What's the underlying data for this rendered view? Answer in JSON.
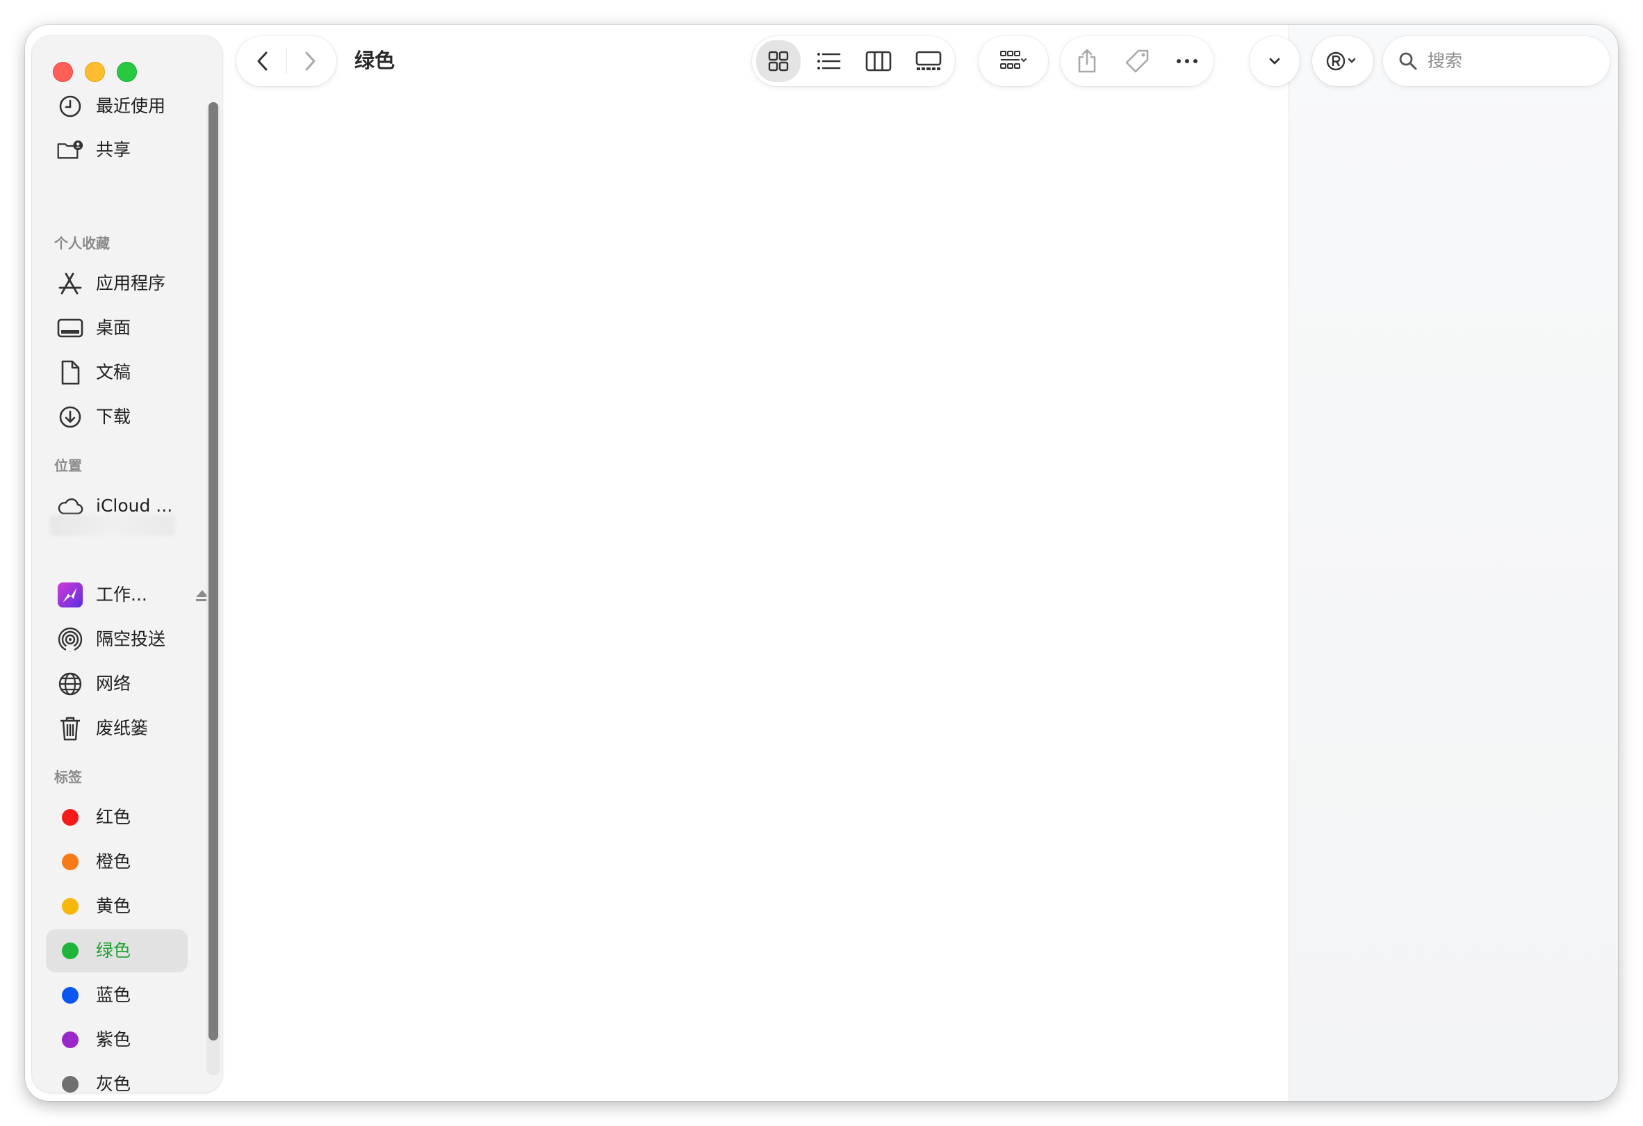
{
  "window": {
    "title": "绿色"
  },
  "search": {
    "placeholder": "搜索"
  },
  "sidebar": {
    "items_top": [
      {
        "label": "最近使用",
        "icon": "clock-icon"
      },
      {
        "label": "共享",
        "icon": "shared-folder-icon"
      }
    ],
    "favorites_heading": "个人收藏",
    "favorites": [
      {
        "label": "应用程序",
        "icon": "applications-icon"
      },
      {
        "label": "桌面",
        "icon": "desktop-icon"
      },
      {
        "label": "文稿",
        "icon": "document-icon"
      },
      {
        "label": "下载",
        "icon": "download-icon"
      }
    ],
    "locations_heading": "位置",
    "locations": [
      {
        "label": "iCloud ...",
        "icon": "cloud-icon"
      },
      {
        "label": "工作...",
        "icon": "app-drive-icon"
      },
      {
        "label": "隔空投送",
        "icon": "airdrop-icon"
      },
      {
        "label": "网络",
        "icon": "globe-icon"
      },
      {
        "label": "废纸篓",
        "icon": "trash-icon"
      }
    ],
    "tags_heading": "标签",
    "tags": [
      {
        "label": "红色",
        "color": "#f41a1a"
      },
      {
        "label": "橙色",
        "color": "#f77a16"
      },
      {
        "label": "黄色",
        "color": "#f7b80b"
      },
      {
        "label": "绿色",
        "color": "#1fb43c"
      },
      {
        "label": "蓝色",
        "color": "#0a57f0"
      },
      {
        "label": "紫色",
        "color": "#9a27c7"
      },
      {
        "label": "灰色",
        "color": "#707070"
      }
    ]
  }
}
